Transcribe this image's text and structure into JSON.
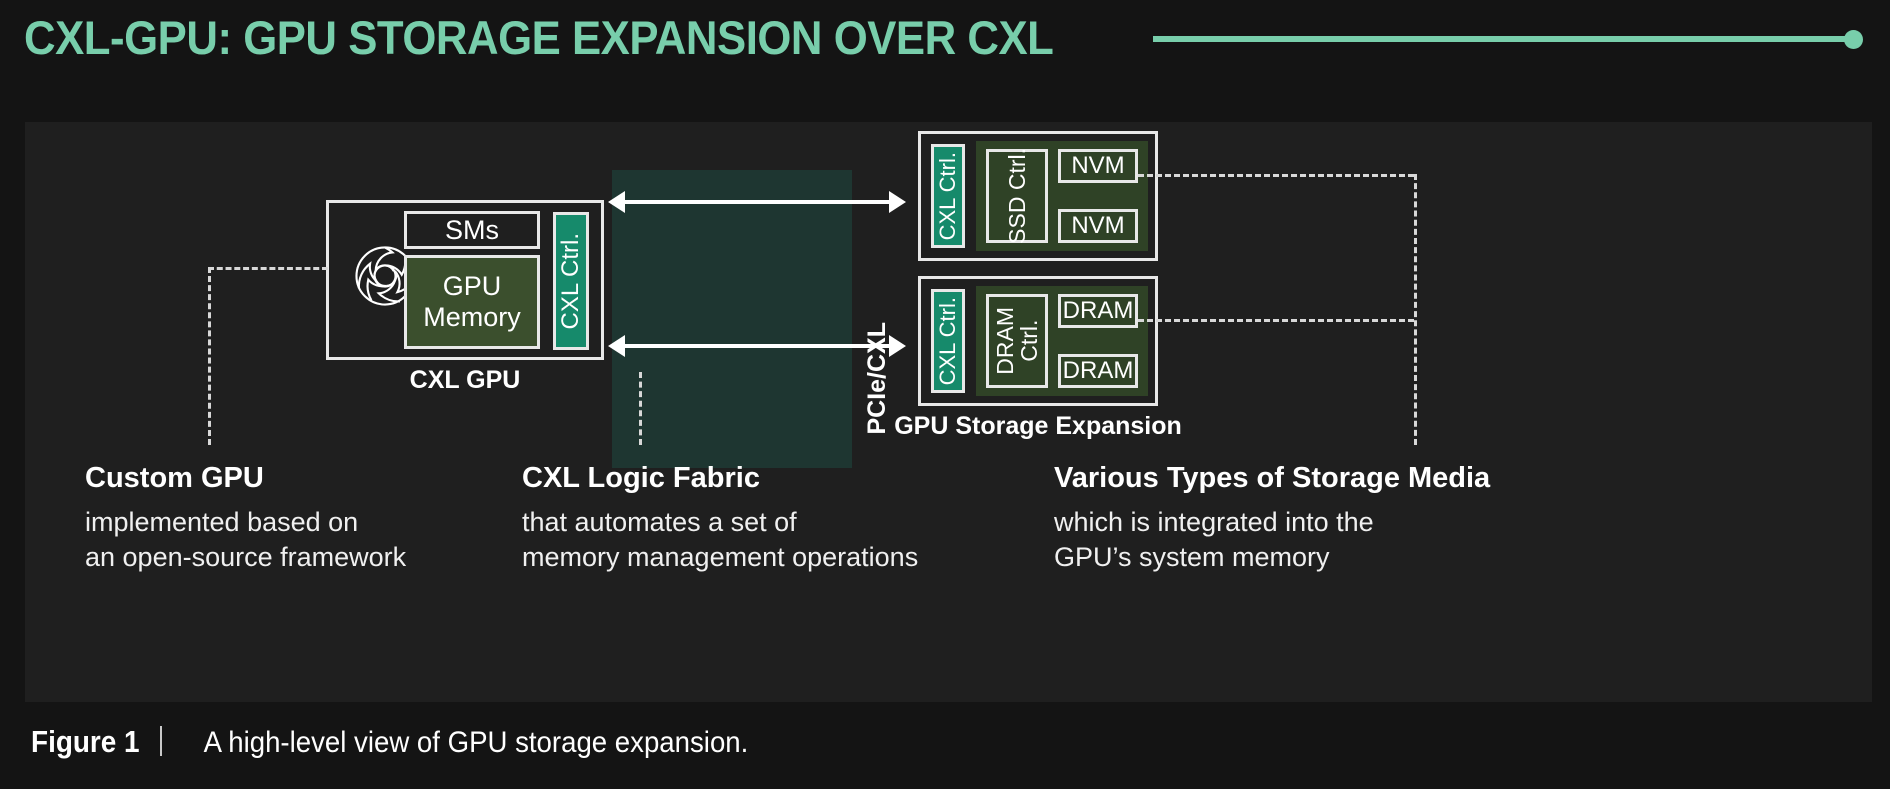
{
  "title": {
    "text": "CXL-GPU: GPU STORAGE EXPANSION OVER CXL",
    "accent_color": "#78ceab"
  },
  "diagram": {
    "gpu_group": {
      "label": "CXL GPU",
      "icon": "gpu-pinwheel-icon",
      "sms": "SMs",
      "gpu_memory": "GPU\nMemory",
      "gpu_memory_line1": "GPU",
      "gpu_memory_line2": "Memory",
      "cxl_ctrl": "CXL Ctrl."
    },
    "interconnect": {
      "label": "PCIe/CXL",
      "arrows": 2,
      "fabric_color": "#1e3631"
    },
    "storage_expansion": {
      "label": "GPU Storage Expansion",
      "ssd_block": {
        "cxl_ctrl": "CXL Ctrl.",
        "controller": "SSD Ctrl.",
        "media": [
          "NVM",
          "NVM"
        ]
      },
      "dram_block": {
        "cxl_ctrl": "CXL Ctrl.",
        "controller_line1": "DRAM",
        "controller_line2": "Ctrl.",
        "media": [
          "DRAM",
          "DRAM"
        ]
      }
    },
    "colors": {
      "teal_accent": "#168a6b",
      "olive_memory": "#3b4f2d",
      "olive_panel": "#2f4226",
      "panel_bg": "#1f1f1f",
      "page_bg": "#141414"
    }
  },
  "annotations": [
    {
      "title": "Custom GPU",
      "line1": "implemented based on",
      "line2": "an open-source framework"
    },
    {
      "title": "CXL Logic Fabric",
      "line1": "that automates a set of",
      "line2": "memory management operations"
    },
    {
      "title": "Various Types of Storage Media",
      "line1": "which is integrated into the",
      "line2": "GPU’s system memory"
    }
  ],
  "caption": {
    "figure_label": "Figure 1",
    "divider": "|",
    "text": "A high-level view of GPU storage expansion."
  }
}
